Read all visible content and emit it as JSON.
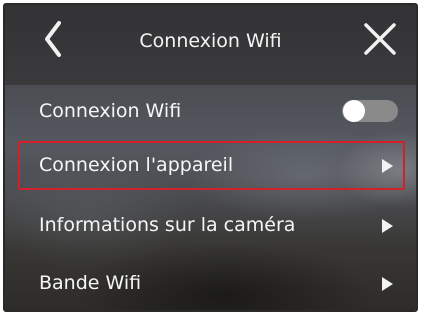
{
  "header": {
    "title": "Connexion Wifi",
    "back_icon": "chevron-left-icon",
    "close_icon": "close-icon"
  },
  "menu": {
    "items": [
      {
        "label": "Connexion Wifi",
        "control": "toggle",
        "toggle_on": false
      },
      {
        "label": "Connexion l'appareil",
        "control": "arrow",
        "selected": true
      },
      {
        "label": "Informations sur la caméra",
        "control": "arrow"
      },
      {
        "label": "Bande Wifi",
        "control": "arrow"
      }
    ]
  },
  "colors": {
    "highlight_border": "#d3202a",
    "text": "#f6f6f6",
    "toggle_off_track": "#8a8a8a"
  }
}
